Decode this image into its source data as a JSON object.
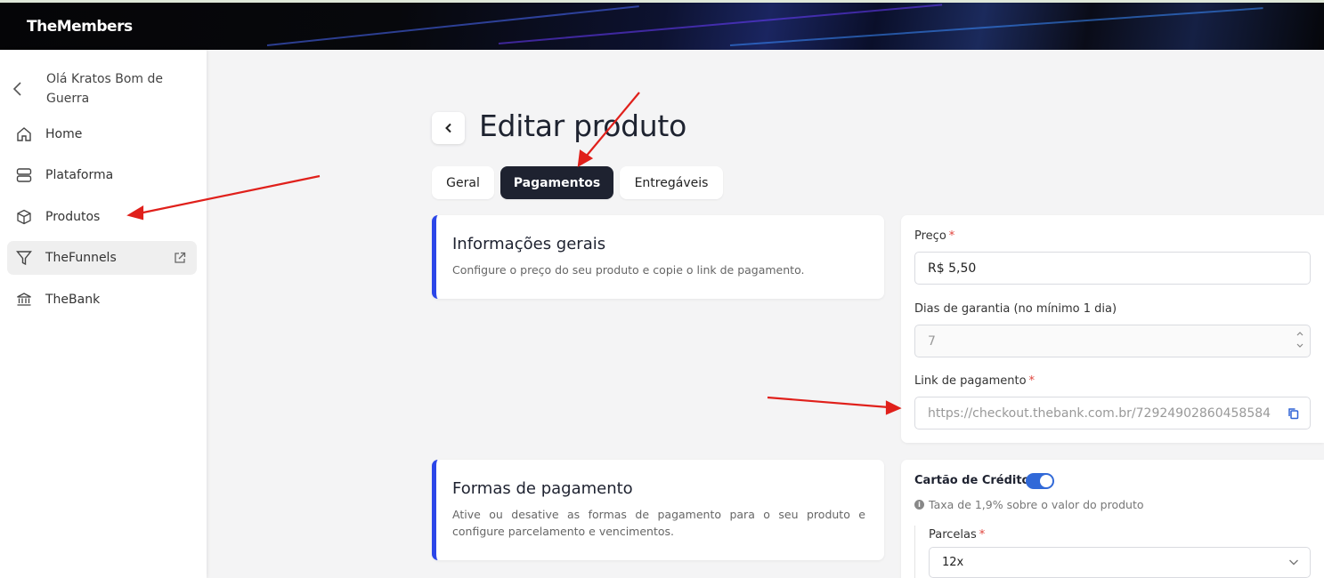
{
  "app": {
    "logo": "TheMembers"
  },
  "sidebar": {
    "greeting": "Olá Kratos Bom de Guerra",
    "items": [
      {
        "label": "Home",
        "icon": "home-icon"
      },
      {
        "label": "Plataforma",
        "icon": "server-icon"
      },
      {
        "label": "Produtos",
        "icon": "box-icon"
      },
      {
        "label": "TheFunnels",
        "icon": "funnel-icon",
        "external": true
      },
      {
        "label": "TheBank",
        "icon": "bank-icon"
      }
    ]
  },
  "page": {
    "title": "Editar produto",
    "tabs": [
      {
        "label": "Geral",
        "active": false
      },
      {
        "label": "Pagamentos",
        "active": true
      },
      {
        "label": "Entregáveis",
        "active": false
      }
    ]
  },
  "general_info": {
    "title": "Informações gerais",
    "description": "Configure o preço do seu produto e copie o link de pagamento."
  },
  "price": {
    "label": "Preço",
    "required_mark": "*",
    "value": "R$ 5,50"
  },
  "warranty": {
    "label": "Dias de garantia (no mínimo 1 dia)",
    "value": "7"
  },
  "payment_link": {
    "label": "Link de pagamento",
    "required_mark": "*",
    "value": "https://checkout.thebank.com.br/72924902860458584"
  },
  "payment_methods": {
    "title": "Formas de pagamento",
    "description": "Ative ou desative as formas de pagamento para o seu produto e configure parcelamento e vencimentos."
  },
  "credit_card": {
    "label": "Cartão de Crédito",
    "enabled": true,
    "fee_note": "Taxa de 1,9% sobre o valor do produto",
    "installments_label": "Parcelas",
    "installments_required_mark": "*",
    "installments_value": "12x"
  },
  "colors": {
    "accent": "#2b46e8",
    "toggle": "#3169d8",
    "active_tab": "#1e2230",
    "annotation_arrow": "#e0201b"
  }
}
